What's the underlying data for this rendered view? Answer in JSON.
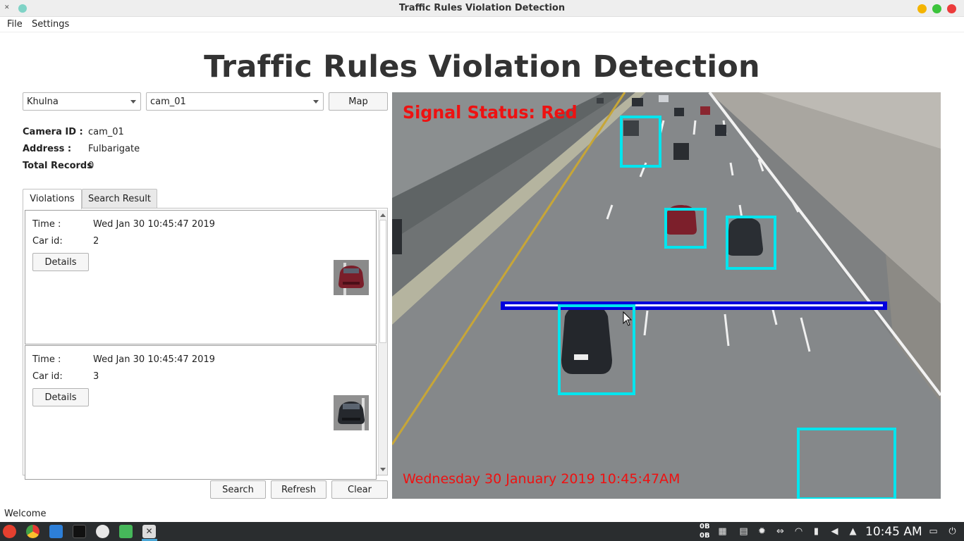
{
  "window": {
    "title": "Traffic Rules Violation Detection"
  },
  "menu": {
    "file": "File",
    "settings": "Settings"
  },
  "heading": "Traffic Rules Violation Detection",
  "controls": {
    "location": "Khulna",
    "camera": "cam_01",
    "map_button": "Map"
  },
  "camera_info": {
    "camera_id_label": "Camera ID :",
    "camera_id": "cam_01",
    "address_label": "Address :",
    "address": "Fulbarigate",
    "total_label": "Total Records",
    "total": "0"
  },
  "tabs": {
    "violations": "Violations",
    "search_result": "Search Result"
  },
  "records": [
    {
      "time_label": "Time :",
      "time": "Wed Jan 30 10:45:47 2019",
      "car_label": "Car id:",
      "car_id": "2",
      "details": "Details"
    },
    {
      "time_label": "Time :",
      "time": "Wed Jan 30 10:45:47 2019",
      "car_label": "Car id:",
      "car_id": "3",
      "details": "Details"
    }
  ],
  "actions": {
    "search": "Search",
    "refresh": "Refresh",
    "clear": "Clear"
  },
  "video": {
    "signal_status": "Signal Status: Red",
    "timestamp": "Wednesday 30 January 2019 10:45:47AM"
  },
  "status": "Welcome",
  "taskbar": {
    "net_up": "0B",
    "net_down": "0B",
    "clock": "10:45 AM"
  },
  "colors": {
    "detection_box": "#00e5ee",
    "stop_line": "#0000dd",
    "overlay_text": "#ee1111"
  }
}
